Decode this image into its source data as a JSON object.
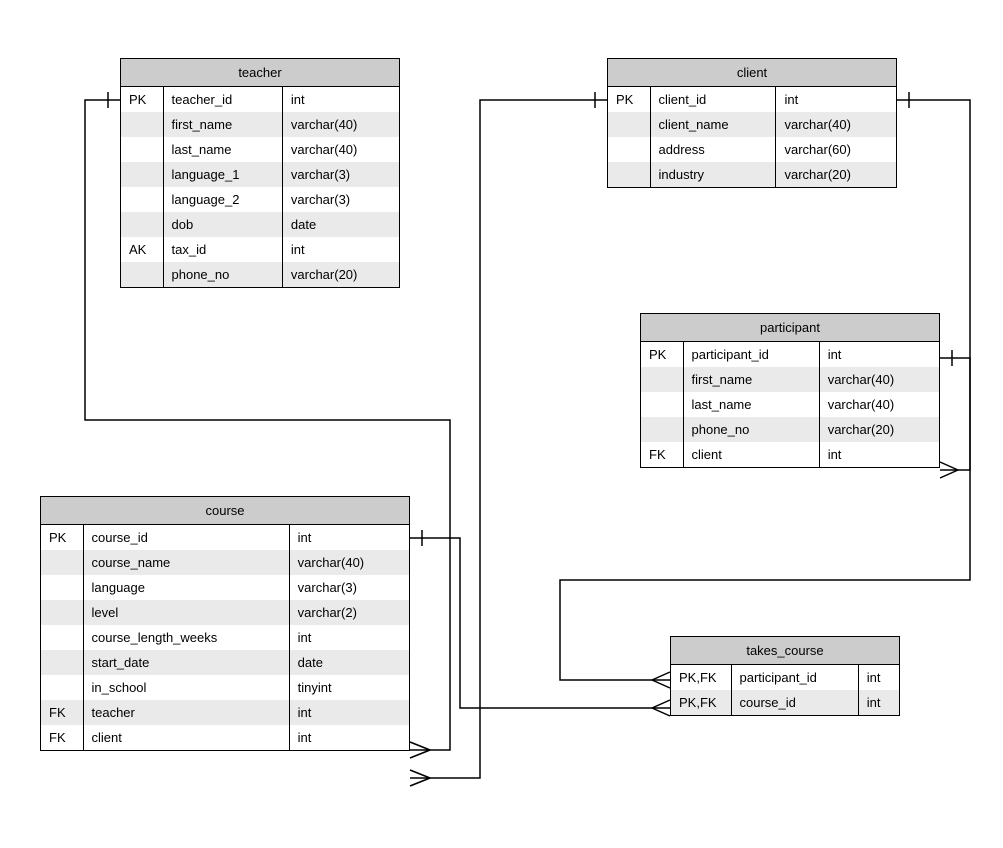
{
  "entities": {
    "teacher": {
      "title": "teacher",
      "rows": [
        {
          "key": "PK",
          "name": "teacher_id",
          "type": "int"
        },
        {
          "key": "",
          "name": "first_name",
          "type": "varchar(40)"
        },
        {
          "key": "",
          "name": "last_name",
          "type": "varchar(40)"
        },
        {
          "key": "",
          "name": "language_1",
          "type": "varchar(3)"
        },
        {
          "key": "",
          "name": "language_2",
          "type": "varchar(3)"
        },
        {
          "key": "",
          "name": "dob",
          "type": "date"
        },
        {
          "key": "AK",
          "name": "tax_id",
          "type": "int"
        },
        {
          "key": "",
          "name": "phone_no",
          "type": "varchar(20)"
        }
      ]
    },
    "client": {
      "title": "client",
      "rows": [
        {
          "key": "PK",
          "name": "client_id",
          "type": "int"
        },
        {
          "key": "",
          "name": "client_name",
          "type": "varchar(40)"
        },
        {
          "key": "",
          "name": "address",
          "type": "varchar(60)"
        },
        {
          "key": "",
          "name": "industry",
          "type": "varchar(20)"
        }
      ]
    },
    "participant": {
      "title": "participant",
      "rows": [
        {
          "key": "PK",
          "name": "participant_id",
          "type": "int"
        },
        {
          "key": "",
          "name": "first_name",
          "type": "varchar(40)"
        },
        {
          "key": "",
          "name": "last_name",
          "type": "varchar(40)"
        },
        {
          "key": "",
          "name": "phone_no",
          "type": "varchar(20)"
        },
        {
          "key": "FK",
          "name": "client",
          "type": "int"
        }
      ]
    },
    "course": {
      "title": "course",
      "rows": [
        {
          "key": "PK",
          "name": "course_id",
          "type": "int"
        },
        {
          "key": "",
          "name": "course_name",
          "type": "varchar(40)"
        },
        {
          "key": "",
          "name": "language",
          "type": "varchar(3)"
        },
        {
          "key": "",
          "name": "level",
          "type": "varchar(2)"
        },
        {
          "key": "",
          "name": "course_length_weeks",
          "type": "int"
        },
        {
          "key": "",
          "name": "start_date",
          "type": "date"
        },
        {
          "key": "",
          "name": "in_school",
          "type": "tinyint"
        },
        {
          "key": "FK",
          "name": "teacher",
          "type": "int"
        },
        {
          "key": "FK",
          "name": "client",
          "type": "int"
        }
      ]
    },
    "takes_course": {
      "title": "takes_course",
      "rows": [
        {
          "key": "PK,FK",
          "name": "participant_id",
          "type": "int"
        },
        {
          "key": "PK,FK",
          "name": "course_id",
          "type": "int"
        }
      ]
    }
  },
  "relationships": [
    {
      "from": "teacher",
      "to": "course",
      "fk_field": "teacher",
      "type": "one-to-many"
    },
    {
      "from": "client",
      "to": "course",
      "fk_field": "client",
      "type": "one-to-many"
    },
    {
      "from": "client",
      "to": "participant",
      "fk_field": "client",
      "type": "one-to-many"
    },
    {
      "from": "participant",
      "to": "takes_course",
      "fk_field": "participant_id",
      "type": "one-to-many"
    },
    {
      "from": "course",
      "to": "takes_course",
      "fk_field": "course_id",
      "type": "one-to-many"
    }
  ]
}
